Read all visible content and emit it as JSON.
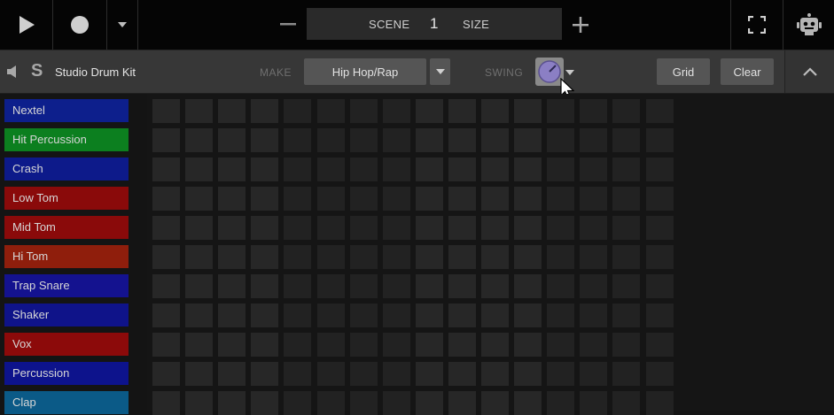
{
  "transport": {
    "play_icon": "play-icon",
    "record_icon": "record-icon",
    "record_menu_icon": "caret-down-icon"
  },
  "scene": {
    "label": "SCENE",
    "value": "1",
    "size_label": "SIZE"
  },
  "window": {
    "fullscreen_icon": "fullscreen-icon",
    "assistant_icon": "robot-icon"
  },
  "kit": {
    "name": "Studio Drum Kit",
    "solo_label": "S",
    "make_label": "MAKE",
    "genre": "Hip Hop/Rap",
    "swing_label": "SWING",
    "swing_knob_color": "#8b7fc4",
    "grid_button": "Grid",
    "clear_button": "Clear"
  },
  "instruments": [
    {
      "label": "Nextel",
      "color": "#0d1f8c"
    },
    {
      "label": "Hit Percussion",
      "color": "#0c7f1f"
    },
    {
      "label": "Crash",
      "color": "#0d1a8a"
    },
    {
      "label": "Low Tom",
      "color": "#8a0a0a"
    },
    {
      "label": "Mid Tom",
      "color": "#8a0a0a"
    },
    {
      "label": "Hi Tom",
      "color": "#8f1e0c"
    },
    {
      "label": "Trap Snare",
      "color": "#14128f"
    },
    {
      "label": "Shaker",
      "color": "#0f1389"
    },
    {
      "label": "Vox",
      "color": "#8c0a0a"
    },
    {
      "label": "Percussion",
      "color": "#0d138c"
    },
    {
      "label": "Clap",
      "color": "#0b5a87"
    }
  ],
  "pattern": {
    "steps": 16,
    "rows": 11
  }
}
